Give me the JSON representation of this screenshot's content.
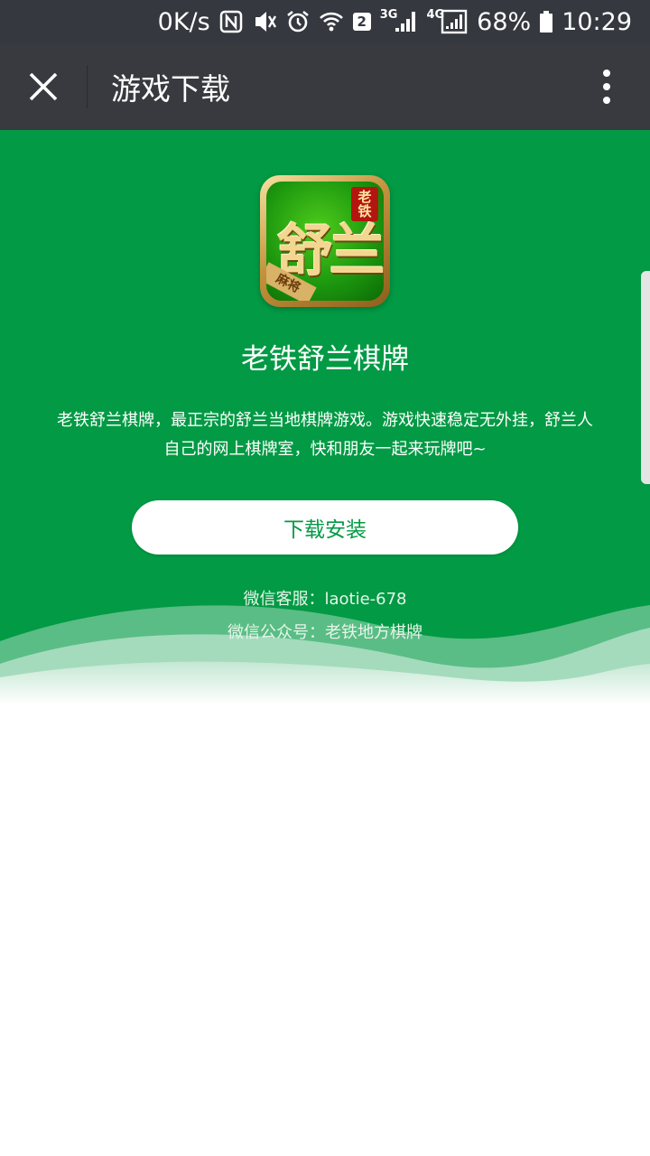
{
  "status_bar": {
    "net_speed": "0K/s",
    "nfc_label": "N",
    "sim_badge": "2",
    "net_3g": "3G",
    "net_4g": "4G",
    "battery": "68%",
    "time": "10:29",
    "icons": [
      "nfc-icon",
      "vibrate-mute-icon",
      "alarm-icon",
      "wifi-icon",
      "signal-3g-icon",
      "signal-4g-icon",
      "battery-icon"
    ]
  },
  "title_bar": {
    "title": "游戏下载",
    "close_icon": "close-icon",
    "more_icon": "more-vertical-icon",
    "background": "#393a3f"
  },
  "app": {
    "icon_tag": [
      "老",
      "铁"
    ],
    "icon_glyph": "舒兰",
    "icon_corner": "麻将",
    "name": "老铁舒兰棋牌",
    "description_line1": "老铁舒兰棋牌，最正宗的舒兰当地棋牌游戏。游戏快速稳定无外挂，舒兰人",
    "description_line2": "自己的网上棋牌室，快和朋友一起来玩牌吧~",
    "download_label": "下载安装",
    "wechat_service": "微信客服：laotie-678",
    "wechat_official": "微信公众号：老铁地方棋牌"
  },
  "colors": {
    "brand_green": "#029a44",
    "status_bar": "#35383f",
    "white": "#ffffff"
  }
}
